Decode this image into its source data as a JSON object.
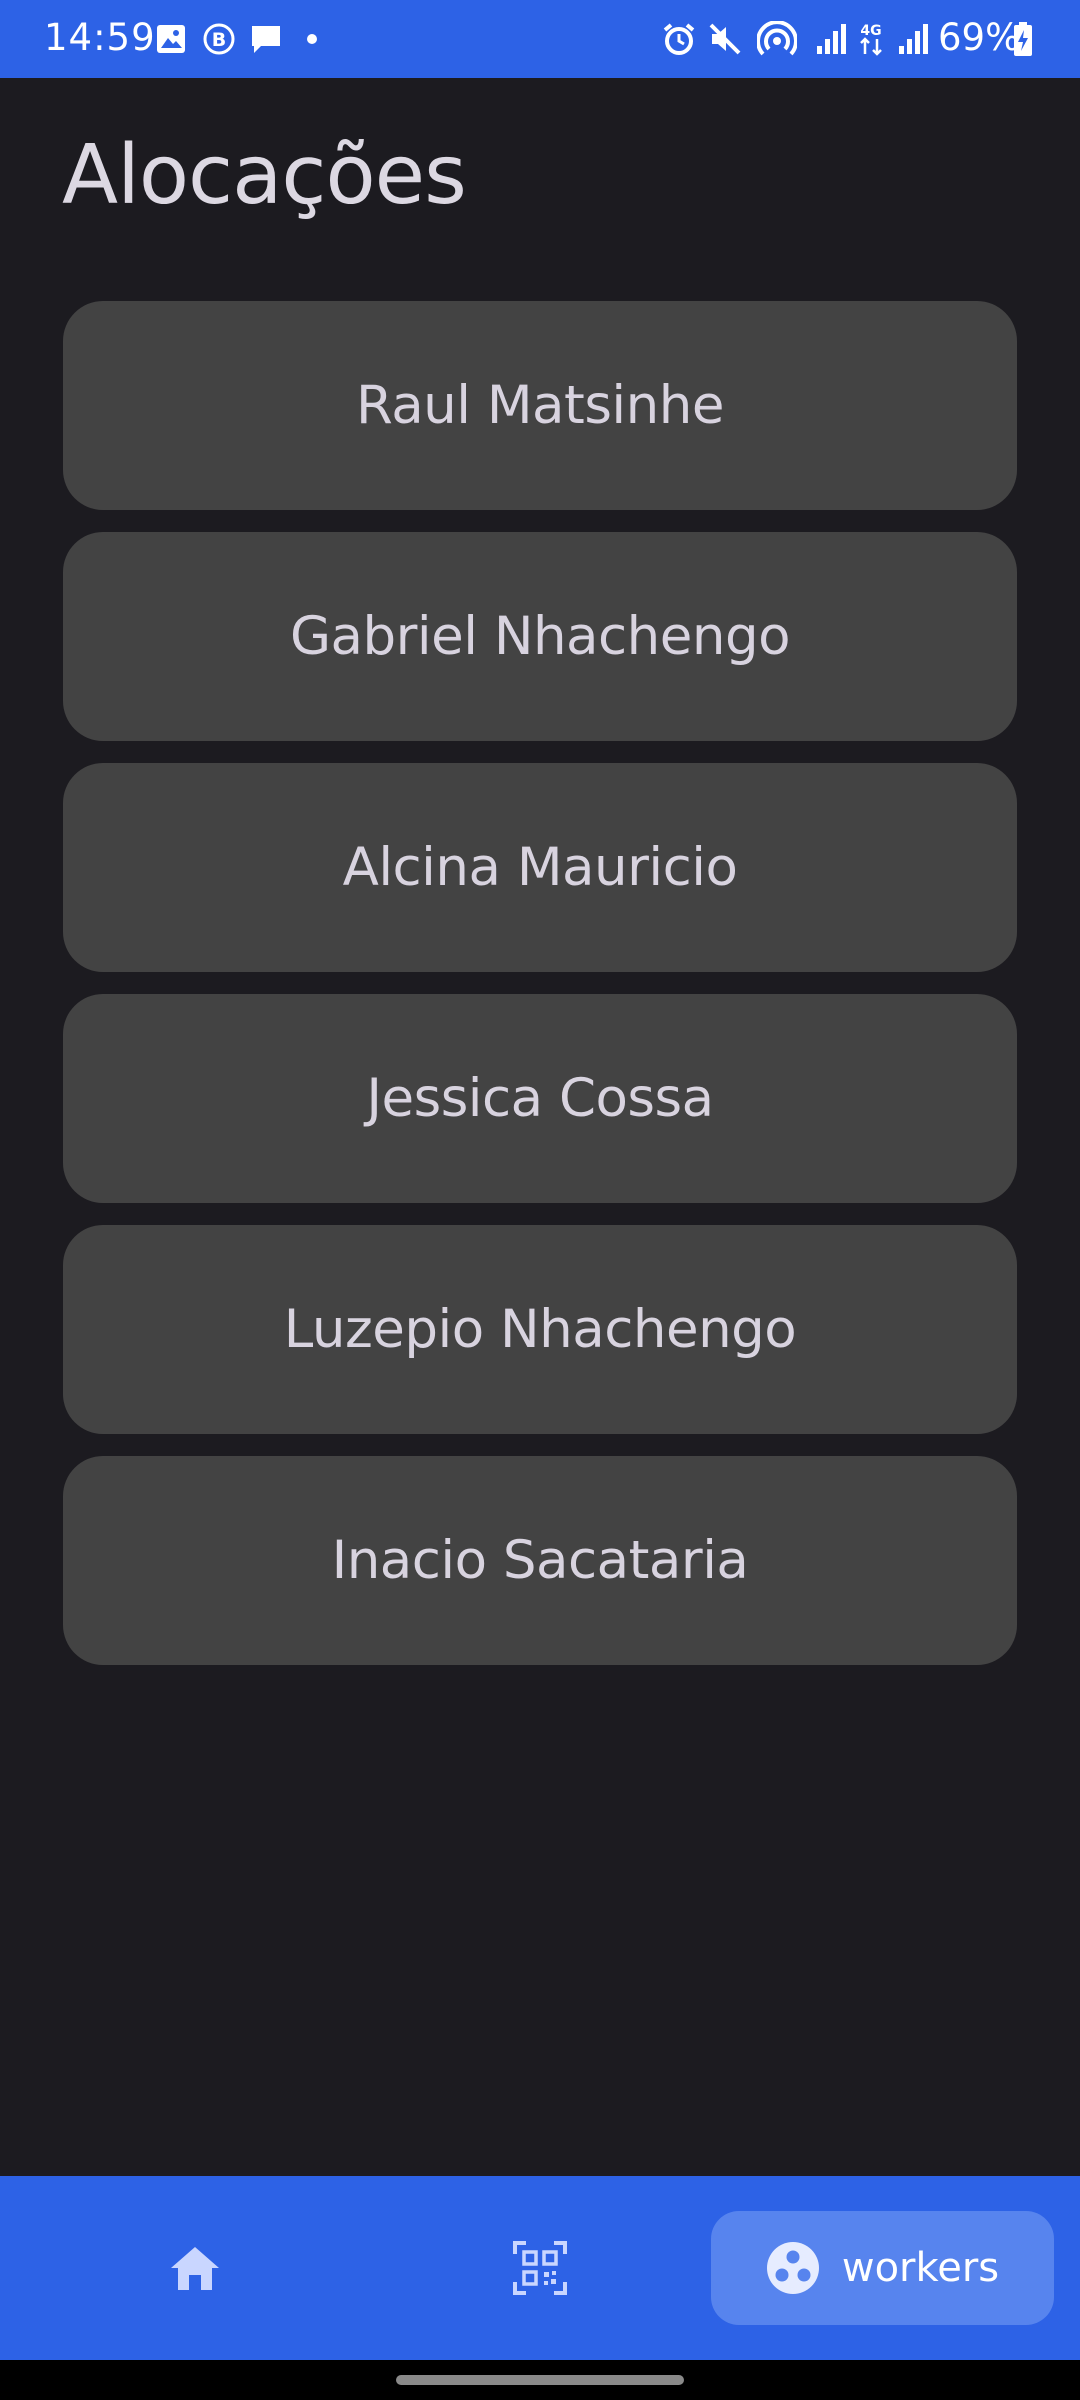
{
  "status_bar": {
    "time": "14:59",
    "battery": "69%",
    "left_icons": [
      "gallery-icon",
      "b-badge-icon",
      "message-icon",
      "dot-icon"
    ],
    "right_icons": [
      "alarm-icon",
      "mute-icon",
      "hotspot-icon",
      "signal-icon",
      "4g-icon",
      "signal-icon",
      "battery-charging-icon"
    ]
  },
  "page": {
    "title": "Alocações"
  },
  "workers": [
    {
      "name": "Raul Matsinhe"
    },
    {
      "name": "Gabriel Nhachengo"
    },
    {
      "name": "Alcina Mauricio"
    },
    {
      "name": "Jessica Cossa"
    },
    {
      "name": "Luzepio Nhachengo"
    },
    {
      "name": "Inacio Sacataria"
    }
  ],
  "bottom_nav": {
    "items": [
      {
        "icon": "home-icon"
      },
      {
        "icon": "qr-scan-icon"
      },
      {
        "icon": "workers-icon",
        "label": "workers",
        "selected": true
      }
    ]
  },
  "colors": {
    "accent": "#2d62e6",
    "background": "#1c1b20",
    "card": "#434343",
    "selected_nav": "#5784ee"
  }
}
